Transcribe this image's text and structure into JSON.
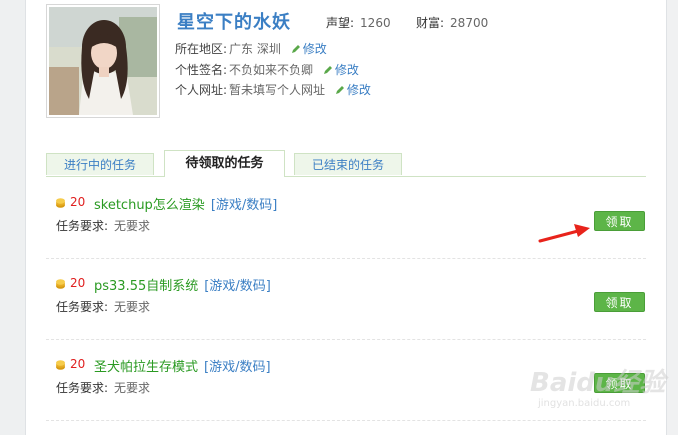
{
  "profile": {
    "username": "星空下的水妖",
    "reputation_label": "声望:",
    "reputation_value": "1260",
    "wealth_label": "财富:",
    "wealth_value": "28700",
    "location_label": "所在地区:",
    "location_value": "广东 深圳",
    "signature_label": "个性签名:",
    "signature_value": "不负如来不负卿",
    "website_label": "个人网址:",
    "website_value": "暂未填写个人网址",
    "edit_label": "修改"
  },
  "tabs": [
    {
      "label": "进行中的任务",
      "active": false
    },
    {
      "label": "待领取的任务",
      "active": true
    },
    {
      "label": "已结束的任务",
      "active": false
    }
  ],
  "tasks": [
    {
      "reward": "20",
      "title": "sketchup怎么渲染",
      "category": "[游戏/数码]",
      "req_label": "任务要求:",
      "req_value": "无要求",
      "button": "领取"
    },
    {
      "reward": "20",
      "title": "ps33.55自制系统",
      "category": "[游戏/数码]",
      "req_label": "任务要求:",
      "req_value": "无要求",
      "button": "领取"
    },
    {
      "reward": "20",
      "title": "圣犬帕拉生存模式",
      "category": "[游戏/数码]",
      "req_label": "任务要求:",
      "req_value": "无要求",
      "button": "领取"
    }
  ],
  "watermark": {
    "text": "Baidu经验",
    "sub": "jingyan.baidu.com"
  },
  "colors": {
    "accent_blue": "#3b7fc4",
    "task_green": "#2a9a22",
    "button_green": "#5db548",
    "reward_red": "#e02020",
    "arrow_red": "#e8231b"
  },
  "icons": [
    "pencil-icon",
    "coin-icon",
    "red-arrow-icon"
  ]
}
